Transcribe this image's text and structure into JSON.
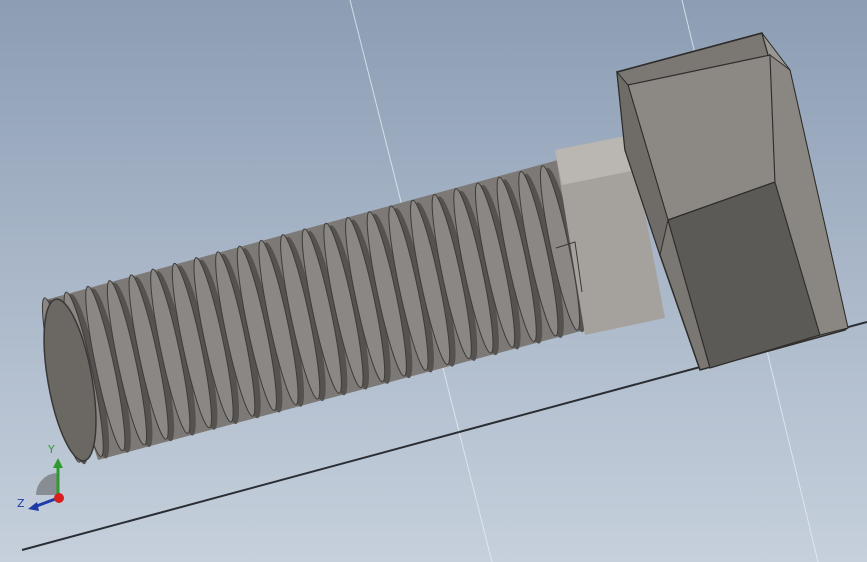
{
  "viewport": {
    "background_top": "#8c9db4",
    "background_bottom": "#c6d0dc",
    "model": "hex-head-bolt"
  },
  "triad": {
    "y_label": "Y",
    "z_label": "Z",
    "x_color": "#d81e1e",
    "y_color": "#2f9a2f",
    "z_color": "#1f3aa8"
  },
  "colors": {
    "thread": "#8a8784",
    "thread_shadow": "#55524f",
    "shank": "#a19e9a",
    "head_light": "#8d8a86",
    "head_dark": "#5b5955"
  }
}
